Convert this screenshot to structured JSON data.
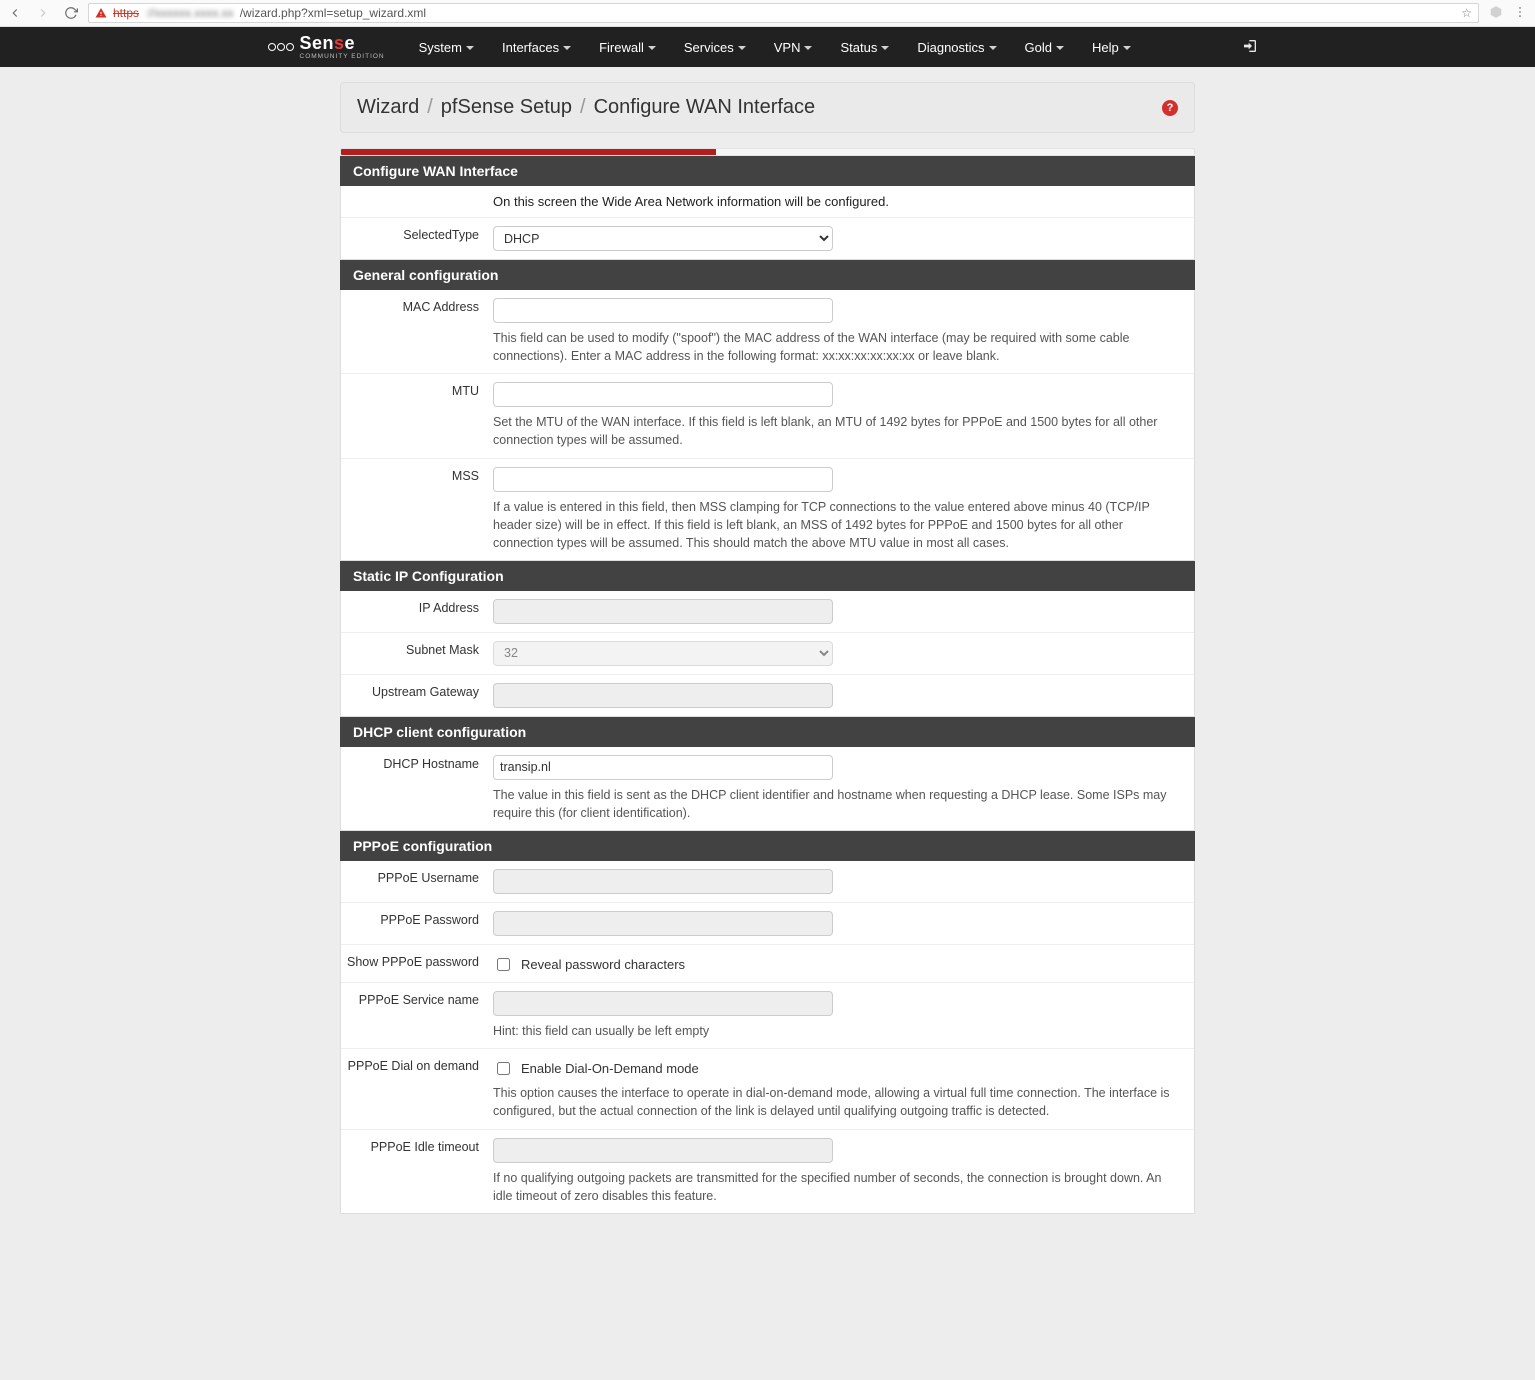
{
  "browser": {
    "url_prefix_struck": "https",
    "url_host_blurred": "://xxxxxx.xxxx.xx",
    "url_path": "/wizard.php?xml=setup_wizard.xml"
  },
  "brand": {
    "name_prefix": "Sen",
    "name_accent": "s",
    "name_suffix": "e",
    "sub": "COMMUNITY EDITION"
  },
  "nav": {
    "items": [
      "System",
      "Interfaces",
      "Firewall",
      "Services",
      "VPN",
      "Status",
      "Diagnostics",
      "Gold",
      "Help"
    ]
  },
  "breadcrumb": {
    "a": "Wizard",
    "b": "pfSense Setup",
    "c": "Configure WAN Interface"
  },
  "progress_pct": 44,
  "sections": {
    "config_wan": {
      "header": "Configure WAN Interface",
      "intro": "On this screen the Wide Area Network information will be configured.",
      "selected_type_label": "SelectedType",
      "selected_type_value": "DHCP"
    },
    "general": {
      "header": "General configuration",
      "mac_label": "MAC Address",
      "mac_help": "This field can be used to modify (\"spoof\") the MAC address of the WAN interface (may be required with some cable connections). Enter a MAC address in the following format: xx:xx:xx:xx:xx:xx or leave blank.",
      "mtu_label": "MTU",
      "mtu_help": "Set the MTU of the WAN interface. If this field is left blank, an MTU of 1492 bytes for PPPoE and 1500 bytes for all other connection types will be assumed.",
      "mss_label": "MSS",
      "mss_help": "If a value is entered in this field, then MSS clamping for TCP connections to the value entered above minus 40 (TCP/IP header size) will be in effect. If this field is left blank, an MSS of 1492 bytes for PPPoE and 1500 bytes for all other connection types will be assumed. This should match the above MTU value in most all cases."
    },
    "static_ip": {
      "header": "Static IP Configuration",
      "ip_label": "IP Address",
      "mask_label": "Subnet Mask",
      "mask_value": "32",
      "gw_label": "Upstream Gateway"
    },
    "dhcp": {
      "header": "DHCP client configuration",
      "host_label": "DHCP Hostname",
      "host_value": "transip.nl",
      "host_help": "The value in this field is sent as the DHCP client identifier and hostname when requesting a DHCP lease. Some ISPs may require this (for client identification)."
    },
    "pppoe": {
      "header": "PPPoE configuration",
      "user_label": "PPPoE Username",
      "pass_label": "PPPoE Password",
      "showpw_label": "Show PPPoE password",
      "showpw_text": "Reveal password characters",
      "svc_label": "PPPoE Service name",
      "svc_help": "Hint: this field can usually be left empty",
      "dod_label": "PPPoE Dial on demand",
      "dod_text": "Enable Dial-On-Demand mode",
      "dod_help": "This option causes the interface to operate in dial-on-demand mode, allowing a virtual full time connection. The interface is configured, but the actual connection of the link is delayed until qualifying outgoing traffic is detected.",
      "idle_label": "PPPoE Idle timeout",
      "idle_help": "If no qualifying outgoing packets are transmitted for the specified number of seconds, the connection is brought down. An idle timeout of zero disables this feature."
    }
  }
}
